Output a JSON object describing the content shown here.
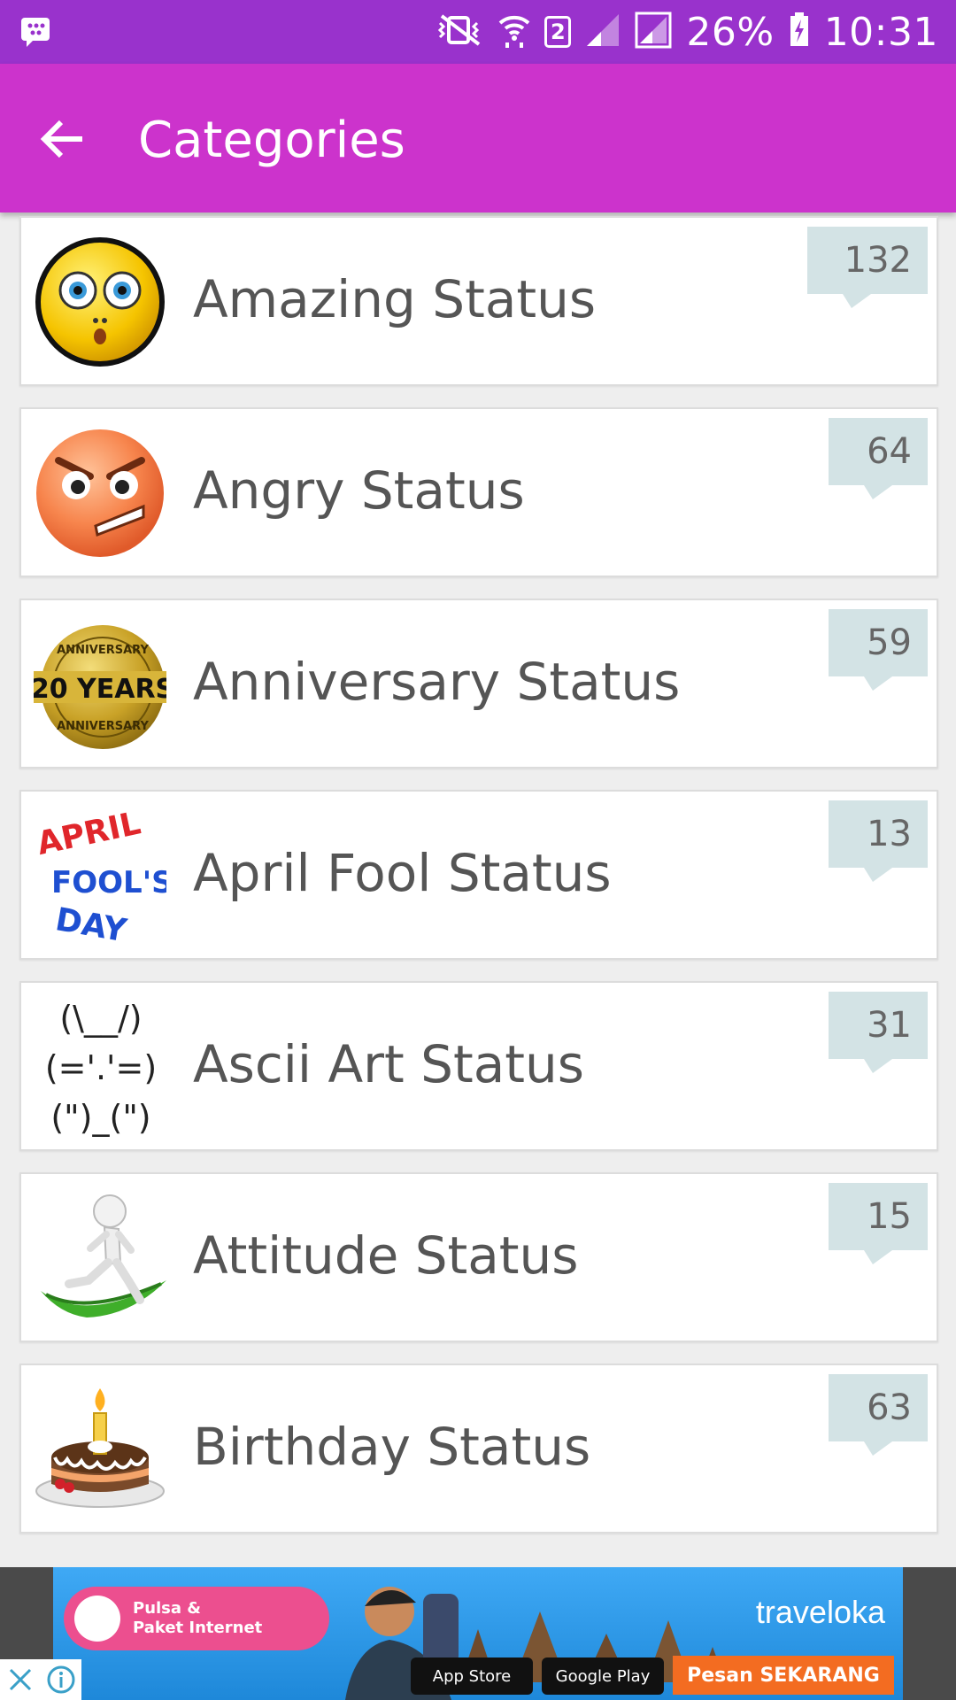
{
  "status_bar": {
    "battery": "26%",
    "time": "10:31",
    "sim_slot": "2",
    "icons": [
      "bbm-notification-icon",
      "vibrate-mute-icon",
      "wifi-icon",
      "sim-2-icon",
      "signal-icon",
      "signal-icon-2",
      "battery-charging-icon"
    ]
  },
  "app_bar": {
    "title": "Categories",
    "back_icon": "arrow-left-icon"
  },
  "categories": [
    {
      "label": "Amazing Status",
      "count": "132",
      "icon": "surprised-emoji-icon"
    },
    {
      "label": "Angry Status",
      "count": "64",
      "icon": "angry-emoji-icon"
    },
    {
      "label": "Anniversary Status",
      "count": "59",
      "icon": "anniversary-badge-icon"
    },
    {
      "label": "April Fool Status",
      "count": "13",
      "icon": "april-fools-day-icon"
    },
    {
      "label": "Ascii Art Status",
      "count": "31",
      "icon": "ascii-bunny-icon"
    },
    {
      "label": "Attitude Status",
      "count": "15",
      "icon": "running-figure-icon"
    },
    {
      "label": "Birthday Status",
      "count": "63",
      "icon": "birthday-cake-icon"
    }
  ],
  "icon_text": {
    "anniversary_top": "ANNIVERSARY",
    "anniversary_main": "20 YEARS",
    "anniversary_bottom": "ANNIVERSARY",
    "april_line1": "APRIL",
    "april_line2": "FOOL'S",
    "april_line3": "DAY",
    "ascii_art": "(\\__/)\n(='.'=)\n(\")_(\")"
  },
  "ad": {
    "pill_text": "Pulsa &\nPaket Internet",
    "brand": "traveloka",
    "app_store": "App Store",
    "google_play": "Google Play",
    "cta": "Pesan SEKARANG",
    "colors": {
      "sky": "#3fa9f5",
      "pill": "#ec4f8f",
      "cta": "#f36c21"
    }
  },
  "colors": {
    "status_bar": "#9932cc",
    "app_bar": "#cc33cc",
    "count_badge": "#d3e3e5",
    "background": "#eeeeee"
  }
}
